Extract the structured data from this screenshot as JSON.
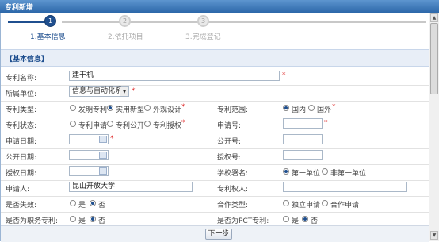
{
  "window": {
    "title": "专利新增"
  },
  "steps": [
    {
      "number": "1",
      "label": "1.基本信息",
      "active": true
    },
    {
      "number": "2",
      "label": "2.依托项目",
      "active": false
    },
    {
      "number": "3",
      "label": "3.完成登记",
      "active": false
    }
  ],
  "section": {
    "title": "【基本信息】"
  },
  "form": {
    "patent_name": {
      "label": "专利名称:",
      "value": "建干机",
      "required": "*"
    },
    "unit": {
      "label": "所属单位:",
      "value": "信息与自动化系",
      "required": "*"
    },
    "patent_type": {
      "label": "专利类型:",
      "options": [
        "发明专利",
        "实用新型",
        "外观设计"
      ],
      "selected": "实用新型",
      "required": "*"
    },
    "patent_scope": {
      "label": "专利范围:",
      "options": [
        "国内",
        "国外"
      ],
      "selected": "国内",
      "required": "*"
    },
    "patent_status": {
      "label": "专利状态:",
      "options": [
        "专利申请",
        "专利公开",
        "专利授权"
      ],
      "selected": "",
      "required": "*"
    },
    "application_no": {
      "label": "申请号:",
      "value": "",
      "required": "*"
    },
    "application_date": {
      "label": "申请日期:",
      "value": "",
      "required": "*"
    },
    "publication_no": {
      "label": "公开号:",
      "value": ""
    },
    "publication_date": {
      "label": "公开日期:",
      "value": ""
    },
    "grant_no": {
      "label": "授权号:",
      "value": ""
    },
    "grant_date": {
      "label": "授权日期:",
      "value": ""
    },
    "school_signature": {
      "label": "学校署名:",
      "options": [
        "第一单位",
        "非第一单位"
      ],
      "selected": "第一单位"
    },
    "applicant": {
      "label": "申请人:",
      "value": "昆山开放大学"
    },
    "patentee": {
      "label": "专利权人:",
      "value": ""
    },
    "is_invalid": {
      "label": "是否失效:",
      "options": [
        "是",
        "否"
      ],
      "selected": "否"
    },
    "cooperation_type": {
      "label": "合作类型:",
      "options": [
        "独立申请",
        "合作申请"
      ],
      "selected": ""
    },
    "is_service": {
      "label": "是否为职务专利:",
      "options": [
        "是",
        "否"
      ],
      "selected": "否"
    },
    "is_pct": {
      "label": "是否为PCT专利:",
      "options": [
        "是",
        "否"
      ],
      "selected": "否"
    }
  },
  "footer": {
    "next_label": "下一步"
  },
  "colors": {
    "accent": "#1f4f8f",
    "required": "#e03030",
    "titlebar": "#3a76b8"
  }
}
